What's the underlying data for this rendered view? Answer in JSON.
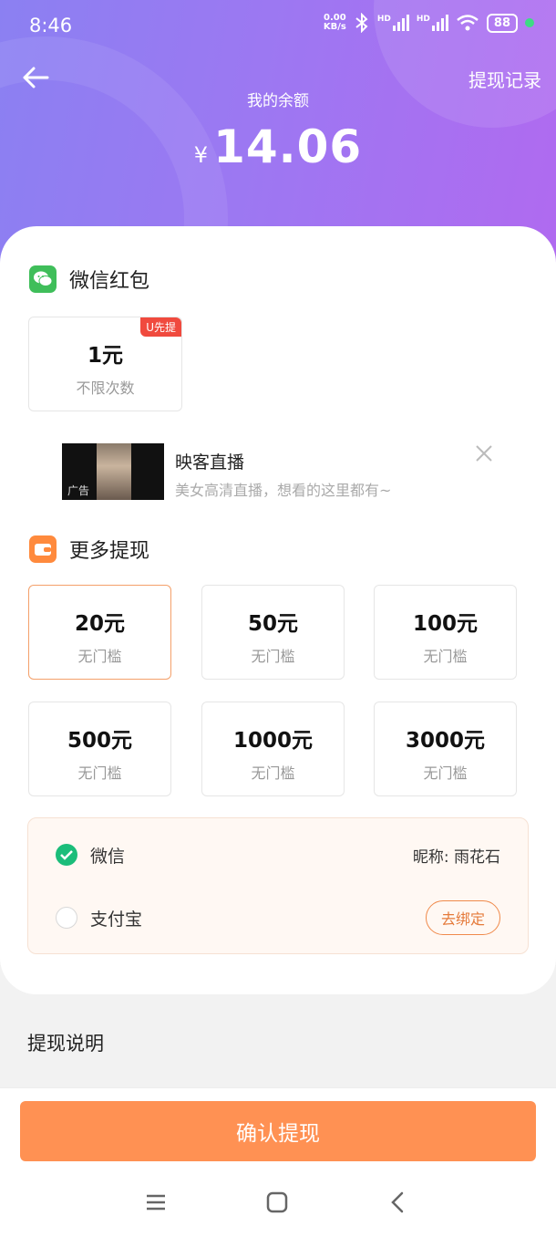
{
  "status_bar": {
    "time": "8:46",
    "net_speed_value": "0.00",
    "net_speed_unit": "KB/s",
    "signal_label_1": "HD",
    "signal_label_2": "HD",
    "battery": "88"
  },
  "header": {
    "records_link": "提现记录",
    "balance_label": "我的余额",
    "currency_symbol": "¥",
    "balance": "14.06"
  },
  "wechat_redpacket": {
    "title": "微信红包",
    "option": {
      "amount": "1元",
      "sub": "不限次数",
      "badge": "U先提"
    }
  },
  "ad": {
    "tag": "广告",
    "title": "映客直播",
    "description": "美女高清直播，想看的这里都有~"
  },
  "more_withdraw": {
    "title": "更多提现",
    "options": [
      {
        "amount": "20元",
        "sub": "无门槛"
      },
      {
        "amount": "50元",
        "sub": "无门槛"
      },
      {
        "amount": "100元",
        "sub": "无门槛"
      },
      {
        "amount": "500元",
        "sub": "无门槛"
      },
      {
        "amount": "1000元",
        "sub": "无门槛"
      },
      {
        "amount": "3000元",
        "sub": "无门槛"
      }
    ],
    "selected_index": 0
  },
  "payment": {
    "wechat": {
      "name": "微信",
      "nickname": "昵称: 雨花石",
      "selected": true
    },
    "alipay": {
      "name": "支付宝",
      "bind_label": "去绑定",
      "selected": false
    }
  },
  "explain_title": "提现说明",
  "confirm_button": "确认提现",
  "colors": {
    "accent": "#ff9153",
    "header_start": "#8b80f2",
    "header_end": "#b06af0",
    "wechat_green": "#1bbd7a",
    "badge_red": "#f04a3e"
  },
  "icons": [
    "back-arrow-icon",
    "wechat-icon",
    "wallet-icon",
    "close-icon",
    "check-icon",
    "menu-icon",
    "home-icon",
    "back-icon"
  ]
}
